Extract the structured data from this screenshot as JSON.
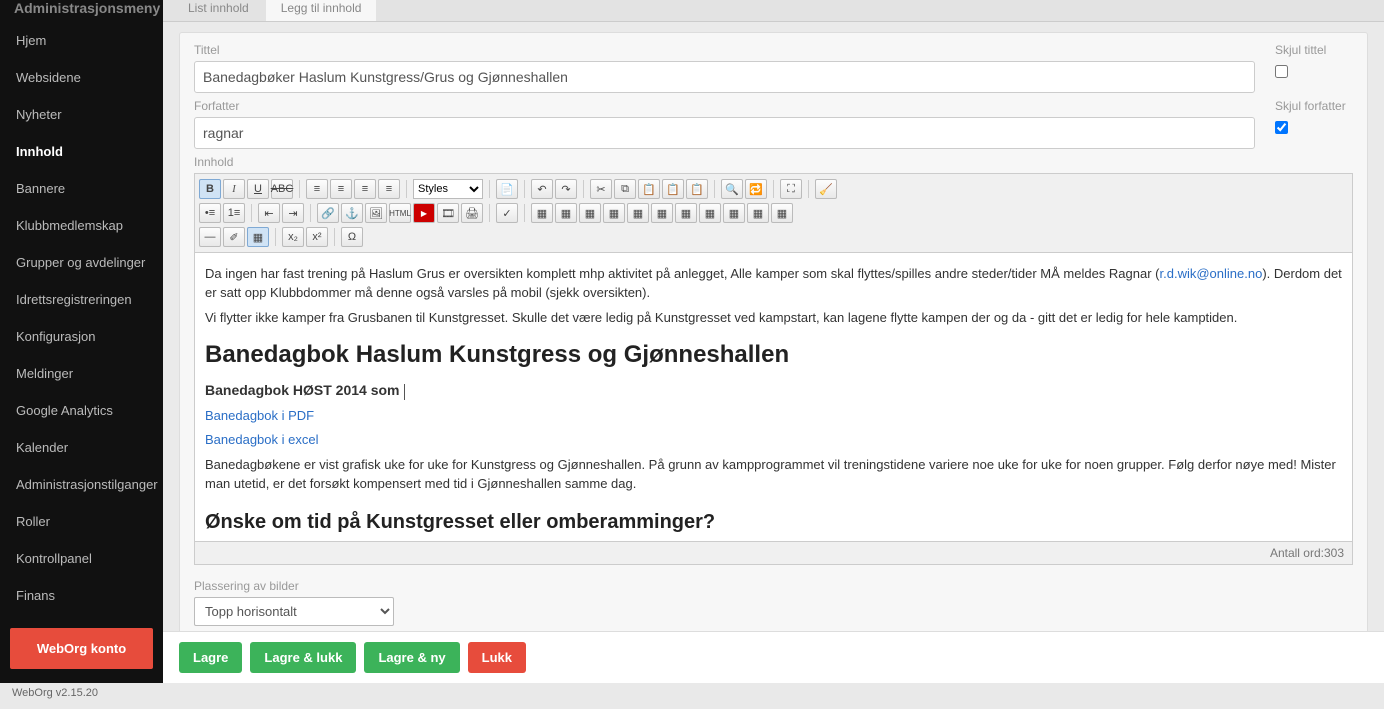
{
  "sidebar": {
    "title": "Administrasjonsmeny",
    "items": [
      "Hjem",
      "Websidene",
      "Nyheter",
      "Innhold",
      "Bannere",
      "Klubbmedlemskap",
      "Grupper og avdelinger",
      "Idrettsregistreringen",
      "Konfigurasjon",
      "Meldinger",
      "Google Analytics",
      "Kalender",
      "Administrasjonstilganger",
      "Roller",
      "Kontrollpanel",
      "Finans"
    ],
    "active_index": 3,
    "konto_button": "WebOrg konto",
    "version": "WebOrg v2.15.20"
  },
  "tabs": {
    "items": [
      "List innhold",
      "Legg til innhold"
    ],
    "active_index": 1
  },
  "form": {
    "tittel_label": "Tittel",
    "tittel_value": "Banedagbøker Haslum Kunstgress/Grus og Gjønneshallen",
    "skjul_tittel_label": "Skjul tittel",
    "skjul_tittel_checked": false,
    "forfatter_label": "Forfatter",
    "forfatter_value": "ragnar",
    "skjul_forfatter_label": "Skjul forfatter",
    "skjul_forfatter_checked": true,
    "innhold_label": "Innhold",
    "styles_label": "Styles",
    "word_count_label": "Antall ord:",
    "word_count": "303",
    "plassering_label": "Plassering av bilder",
    "plassering_value": "Topp horisontalt"
  },
  "editor_content": {
    "p1_before": "Da ingen har fast trening på Haslum Grus er oversikten komplett mhp aktivitet på anlegget,  Alle kamper som skal flyttes/spilles andre steder/tider MÅ meldes Ragnar (",
    "p1_link_text": "r.d.wik@online.no",
    "p1_after": ").  Derdom det er satt opp Klubbdommer må denne også varsles på mobil (sjekk oversikten).",
    "p2": "Vi flytter ikke kamper fra Grusbanen til Kunstgresset.  Skulle det være ledig på Kunstgresset ved kampstart, kan lagene flytte kampen der og da - gitt det er ledig for hele kamptiden.",
    "h2": "Banedagbok Haslum Kunstgress og Gjønneshallen",
    "sub1": "Banedagbok HØST 2014 som",
    "link_pdf": "Banedagbok i PDF",
    "link_excel": "Banedagbok i excel",
    "p3": "Banedagbøkene er vist grafisk uke for uke for Kunstgress og Gjønneshallen.  På grunn av kampprogrammet vil treningstidene variere noe uke for uke for noen grupper.  Følg derfor nøye med!  Mister man utetid, er det forsøkt kompensert med tid i Gjønneshallen samme dag.",
    "h3": "Ønske om tid på Kunstgresset eller omberamminger?"
  },
  "actions": {
    "save": "Lagre",
    "save_close": "Lagre & lukk",
    "save_new": "Lagre & ny",
    "close": "Lukk"
  }
}
